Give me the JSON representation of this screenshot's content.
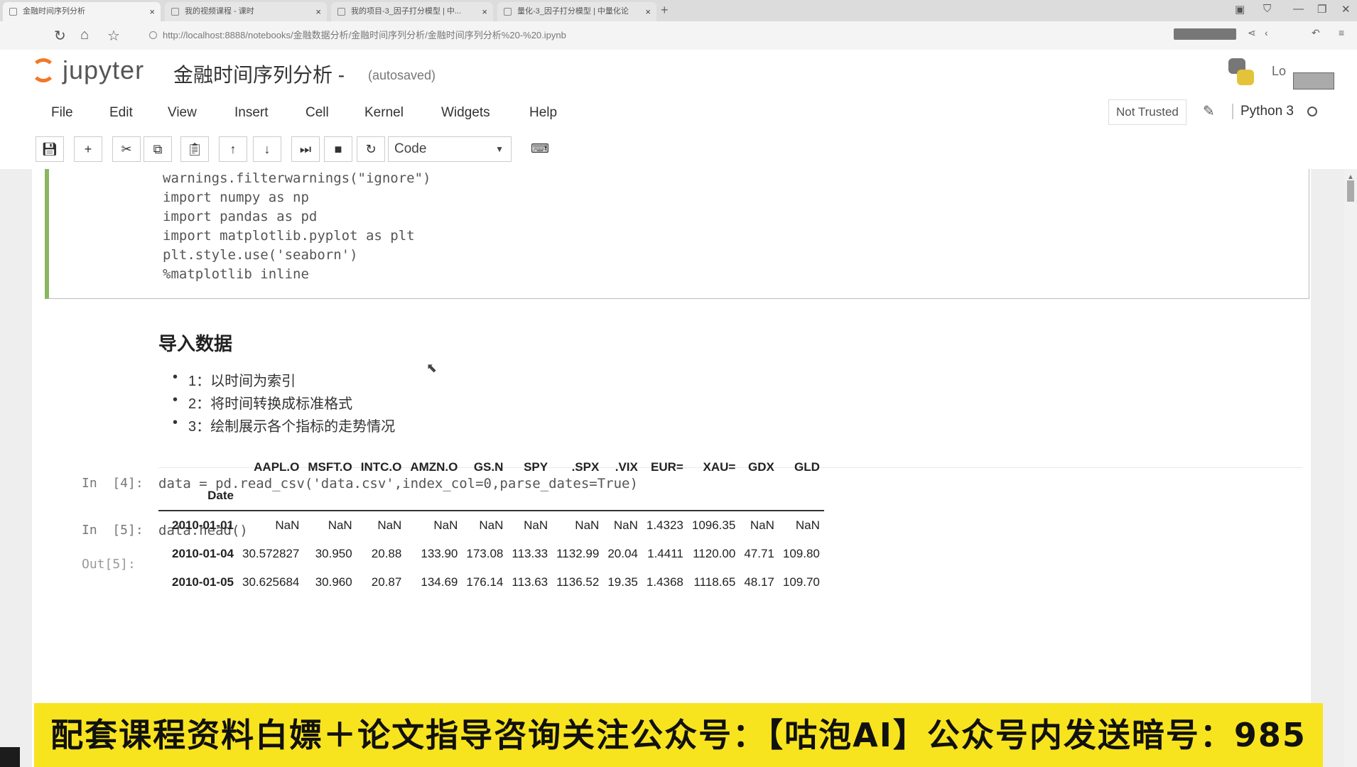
{
  "browser": {
    "tabs": [
      {
        "label": "金融时间序列分析",
        "active": true
      },
      {
        "label": "我的视频课程 - 课时",
        "active": false
      },
      {
        "label": "我的项目-3_因子打分模型 | 中...",
        "active": false
      },
      {
        "label": "量化-3_因子打分模型 | 中量化论",
        "active": false
      }
    ],
    "url": "http://localhost:8888/notebooks/金融数据分析/金融时间序列分析/金融时间序列分析%20-%20.ipynb"
  },
  "jupyter": {
    "logo_text": "jupyter",
    "notebook_title": "金融时间序列分析 -",
    "autosave_status": "(autosaved)",
    "logout_label": "Lo",
    "menu": [
      "File",
      "Edit",
      "View",
      "Insert",
      "Cell",
      "Kernel",
      "Widgets",
      "Help"
    ],
    "trust_status": "Not Trusted",
    "kernel_name": "Python 3",
    "cell_type": "Code"
  },
  "cells": {
    "imports_code": [
      "warnings.filterwarnings(\"ignore\")",
      "import numpy as np",
      "import pandas as pd",
      "import matplotlib.pyplot as plt",
      "plt.style.use('seaborn')",
      "%matplotlib inline"
    ],
    "markdown_heading": "导入数据",
    "markdown_items": [
      "1：以时间为索引",
      "2：将时间转换成标准格式",
      "3：绘制展示各个指标的走势情况"
    ],
    "cell4_prompt": "In  [4]:",
    "cell4_code": "data = pd.read_csv('data.csv',index_col=0,parse_dates=True)",
    "cell5_prompt": "In  [5]:",
    "cell5_code": "data.head()",
    "out5_prompt": "Out[5]:"
  },
  "dataframe": {
    "columns": [
      "AAPL.O",
      "MSFT.O",
      "INTC.O",
      "AMZN.O",
      "GS.N",
      "SPY",
      ".SPX",
      ".VIX",
      "EUR=",
      "XAU=",
      "GDX",
      "GLD"
    ],
    "index_name": "Date",
    "rows": [
      {
        "date": "2010-01-01",
        "values": [
          "NaN",
          "NaN",
          "NaN",
          "NaN",
          "NaN",
          "NaN",
          "NaN",
          "NaN",
          "1.4323",
          "1096.35",
          "NaN",
          "NaN"
        ]
      },
      {
        "date": "2010-01-04",
        "values": [
          "30.572827",
          "30.950",
          "20.88",
          "133.90",
          "173.08",
          "113.33",
          "1132.99",
          "20.04",
          "1.4411",
          "1120.00",
          "47.71",
          "109.80"
        ]
      },
      {
        "date": "2010-01-05",
        "values": [
          "30.625684",
          "30.960",
          "20.87",
          "134.69",
          "176.14",
          "113.63",
          "1136.52",
          "19.35",
          "1.4368",
          "1118.65",
          "48.17",
          "109.70"
        ]
      }
    ]
  },
  "banner_text": "配套课程资料白嫖＋论文指导咨询关注公众号：【咕泡AI】公众号内发送暗号：985"
}
